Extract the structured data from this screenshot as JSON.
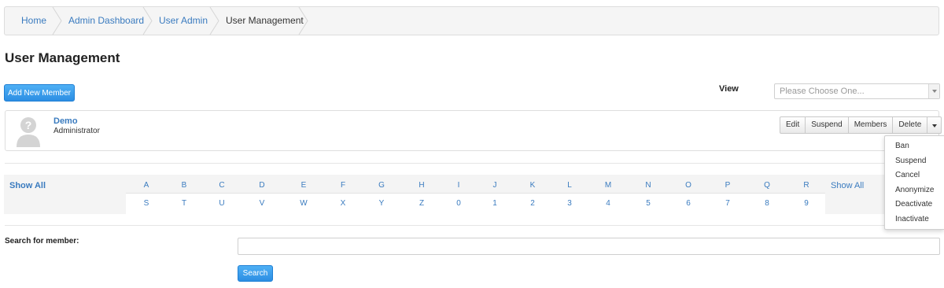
{
  "breadcrumb": [
    {
      "label": "Home"
    },
    {
      "label": "Admin Dashboard"
    },
    {
      "label": "User Admin"
    },
    {
      "label": "User Management"
    }
  ],
  "page_title": "User Management",
  "add_member_label": "Add New Member",
  "view": {
    "label": "View",
    "placeholder": "Please Choose One..."
  },
  "member": {
    "name": "Demo",
    "role": "Administrator",
    "avatar_icon": "user-silhouette-icon",
    "actions": [
      "Edit",
      "Suspend",
      "Members",
      "Delete"
    ]
  },
  "dropdown_items": [
    "Ban",
    "Suspend",
    "Cancel",
    "Anonymize",
    "Deactivate",
    "Inactivate"
  ],
  "alphabet": {
    "show_all": "Show All",
    "row1": [
      "A",
      "B",
      "C",
      "D",
      "E",
      "F",
      "G",
      "H",
      "I",
      "J",
      "K",
      "L",
      "M",
      "N",
      "O",
      "P",
      "Q",
      "R"
    ],
    "row2": [
      "S",
      "T",
      "U",
      "V",
      "W",
      "X",
      "Y",
      "Z",
      "0",
      "1",
      "2",
      "3",
      "4",
      "5",
      "6",
      "7",
      "8",
      "9"
    ]
  },
  "search": {
    "label": "Search for member:",
    "value": "",
    "button_label": "Search"
  },
  "colors": {
    "link": "#3a7bbf",
    "primary": "#2c8ee3"
  }
}
